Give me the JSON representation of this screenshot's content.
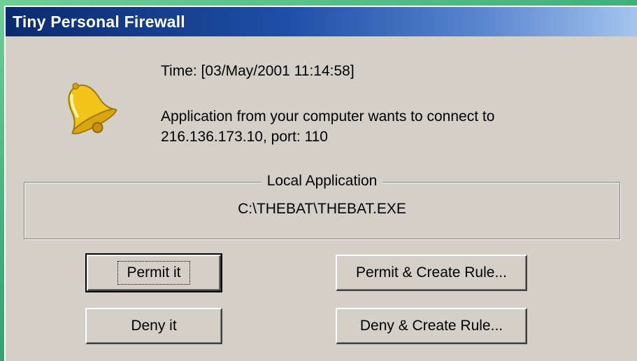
{
  "window": {
    "title": "Tiny Personal Firewall"
  },
  "alert": {
    "icon": "bell-icon",
    "time": "Time: [03/May/2001 11:14:58]",
    "message_line1": "Application from your computer wants to connect to",
    "message_line2": "216.136.173.10, port: 110"
  },
  "local_application": {
    "legend": "Local Application",
    "path": "C:\\THEBAT\\THEBAT.EXE"
  },
  "buttons": {
    "permit": "Permit it",
    "deny": "Deny it",
    "permit_rule": "Permit & Create Rule...",
    "deny_rule": "Deny & Create Rule..."
  },
  "colors": {
    "dialog_bg": "#d4d0c8",
    "titlebar_start": "#0a2b6e",
    "titlebar_end": "#a6c6ef",
    "bell": "#f2c31b"
  }
}
